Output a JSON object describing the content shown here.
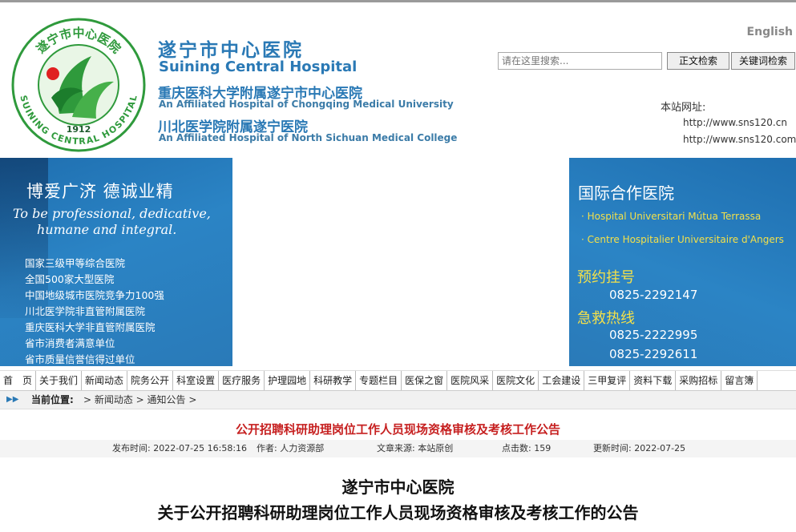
{
  "header": {
    "name_cn": "遂宁市中心医院",
    "name_en": "Suining Central Hospital",
    "affiliation1_cn": "重庆医科大学附属遂宁市中心医院",
    "affiliation1_en": "An Affiliated Hospital of Chongqing Medical University",
    "affiliation2_cn": "川北医学院附属遂宁医院",
    "affiliation2_en": "An Affiliated Hospital of North Sichuan Medical College",
    "logo_cn": "遂宁市中心医院",
    "logo_en": "SUINING CENTRAL HOSPITAL",
    "logo_year": "1912",
    "language_link": "English"
  },
  "search": {
    "placeholder": "请在这里搜索...",
    "fulltext_button": "正文检索",
    "keyword_button": "关键词检索"
  },
  "site": {
    "label": "本站网址:",
    "urls": [
      "http://www.sns120.cn",
      "http://www.sns120.com"
    ]
  },
  "banner_left": {
    "slogan": "博爱广济  德诚业精",
    "slogan_en_line1": "To be professional, dedicative,",
    "slogan_en_line2": "humane and integral.",
    "honors": [
      "国家三级甲等综合医院",
      "全国500家大型医院",
      "中国地级城市医院竞争力100强",
      "川北医学院非直管附属医院",
      "重庆医科大学非直管附属医院",
      "省市消费者满意单位",
      "省市质量信誉信得过单位"
    ]
  },
  "banner_right": {
    "title": "国际合作医院",
    "partners": [
      "· Hospital Universitari Mútua Terrassa",
      "· Centre Hospitalier Universitaire d'Angers"
    ],
    "appointment_label": "预约挂号",
    "appointment_phone": "0825-2292147",
    "emergency_label": "急救热线",
    "emergency_phones": [
      "0825-2222995",
      "0825-2292611"
    ]
  },
  "nav": [
    "首　页",
    "关于我们",
    "新闻动态",
    "院务公开",
    "科室设置",
    "医疗服务",
    "护理园地",
    "科研教学",
    "专题栏目",
    "医保之窗",
    "医院风采",
    "医院文化",
    "工会建设",
    "三甲复评",
    "资料下载",
    "采购招标",
    "留言簿"
  ],
  "breadcrumb": {
    "arrow": "▶▶",
    "label": "当前位置:",
    "path": "> 新闻动态 > 通知公告 >"
  },
  "article": {
    "title": "公开招聘科研助理岗位工作人员现场资格审核及考核工作公告",
    "publish_time": "发布时间: 2022-07-25 16:58:16",
    "author": "作者: 人力资源部",
    "source": "文章来源: 本站原创",
    "clicks": "点击数: 159",
    "updated": "更新时间: 2022-07-25",
    "heading1": "遂宁市中心医院",
    "heading2": "关于公开招聘科研助理岗位工作人员现场资格审核及考核工作的公告"
  },
  "colors": {
    "brand_blue": "#2a79b5",
    "banner_blue": "#2b84c5",
    "highlight_yellow": "#f3e04a",
    "title_red": "#c62020",
    "logo_green": "#2f9a3c"
  }
}
